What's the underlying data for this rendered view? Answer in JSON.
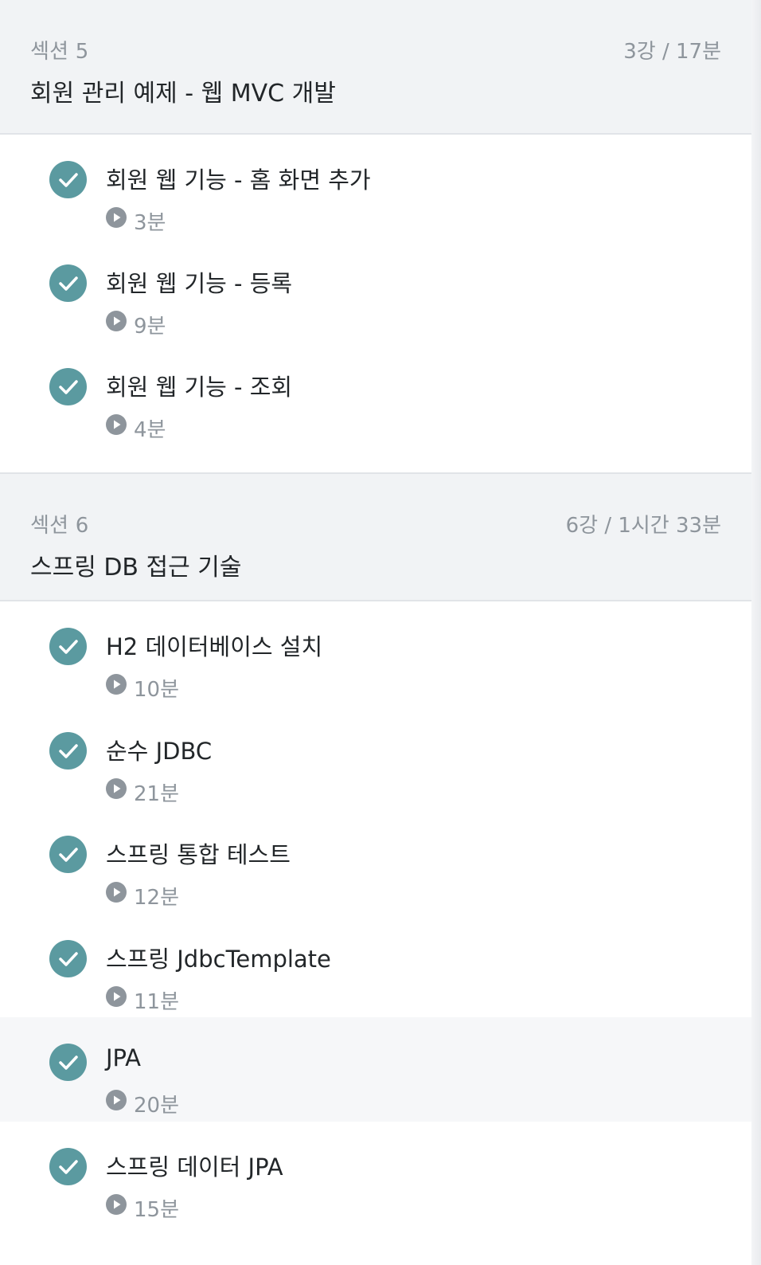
{
  "sections": [
    {
      "label": "섹션 5",
      "meta": "3강 / 17분",
      "title": "회원 관리 예제 - 웹 MVC 개발",
      "lessons": [
        {
          "title": "회원 웹 기능 - 홈 화면 추가",
          "duration": "3분",
          "completed": true
        },
        {
          "title": "회원 웹 기능 - 등록",
          "duration": "9분",
          "completed": true
        },
        {
          "title": "회원 웹 기능 - 조회",
          "duration": "4분",
          "completed": true
        }
      ]
    },
    {
      "label": "섹션 6",
      "meta": "6강 / 1시간 33분",
      "title": "스프링 DB 접근 기술",
      "lessons": [
        {
          "title": "H2 데이터베이스 설치",
          "duration": "10분",
          "completed": true
        },
        {
          "title": "순수 JDBC",
          "duration": "21분",
          "completed": true
        },
        {
          "title": "스프링 통합 테스트",
          "duration": "12분",
          "completed": true
        },
        {
          "title": "스프링 JdbcTemplate",
          "duration": "11분",
          "completed": true
        },
        {
          "title": "JPA",
          "duration": "20분",
          "completed": true,
          "highlighted": true
        },
        {
          "title": "스프링 데이터 JPA",
          "duration": "15분",
          "completed": true
        }
      ]
    }
  ],
  "icons": {
    "completed": "check-circle-icon",
    "video": "play-circle-icon"
  },
  "colors": {
    "check": "#5b9aa0",
    "header_bg": "#f1f3f5",
    "muted": "#8e959c",
    "text": "#222629"
  }
}
